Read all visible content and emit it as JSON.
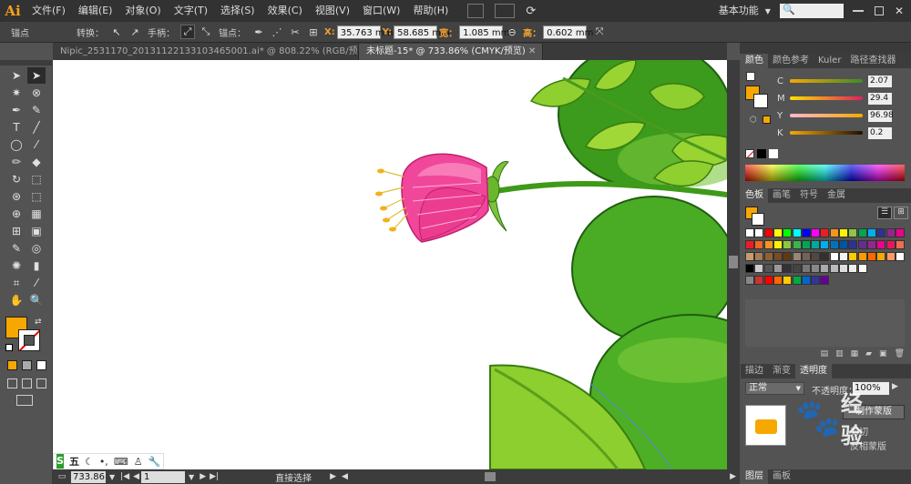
{
  "app": {
    "logo": "Ai",
    "menus": [
      "文件(F)",
      "编辑(E)",
      "对象(O)",
      "文字(T)",
      "选择(S)",
      "效果(C)",
      "视图(V)",
      "窗口(W)",
      "帮助(H)"
    ],
    "workspace": "基本功能",
    "search_placeholder": ""
  },
  "control_bar": {
    "tool_name": "锚点",
    "convert_label": "转换：",
    "handles_label": "手柄：",
    "anchors_label": "锚点：",
    "x_label": "X:",
    "x_value": "35.763 mm",
    "y_label": "Y:",
    "y_value": "58.685 mm",
    "w_label": "宽：",
    "w_value": "1.085 mm",
    "h_label": "高：",
    "h_value": "0.602 mm"
  },
  "tabs": [
    {
      "label": "Nipic_2531170_20131122133103465001.ai* @ 808.22% (RGB/预览)"
    },
    {
      "label": "未标题-15* @ 733.86% (CMYK/预览)"
    }
  ],
  "toolbox": {
    "icons": [
      "selection-tool-icon",
      "direct-selection-tool-icon",
      "magic-wand-tool-icon",
      "lasso-tool-icon",
      "pen-tool-icon",
      "curvature-tool-icon",
      "type-tool-icon",
      "line-tool-icon",
      "rectangle-tool-icon",
      "paintbrush-tool-icon",
      "pencil-tool-icon",
      "eraser-tool-icon",
      "rotate-tool-icon",
      "scale-tool-icon",
      "warp-tool-icon",
      "free-transform-tool-icon",
      "shape-builder-tool-icon",
      "perspective-tool-icon",
      "mesh-tool-icon",
      "gradient-tool-icon",
      "eyedropper-tool-icon",
      "blend-tool-icon",
      "symbol-sprayer-tool-icon",
      "column-graph-tool-icon",
      "artboard-tool-icon",
      "slice-tool-icon",
      "hand-tool-icon",
      "zoom-tool-icon"
    ]
  },
  "colors": {
    "fill": "#f7a800",
    "accent": "#f7a21b",
    "canvas": "#ffffff"
  },
  "color_panel": {
    "tabs": [
      "颜色",
      "颜色参考",
      "Kuler",
      "路径查找器"
    ],
    "c_label": "C",
    "c": "2.07",
    "m_label": "M",
    "m": "29.4",
    "y_label": "Y",
    "y": "96.98",
    "k_label": "K",
    "k": "0.2"
  },
  "swatches_panel": {
    "tabs": [
      "色板",
      "画笔",
      "符号",
      "金属"
    ]
  },
  "transparency_panel": {
    "tabs": [
      "描边",
      "渐变",
      "透明度"
    ],
    "mode": "正常",
    "opacity_label": "不透明度：",
    "opacity": "100%",
    "make_mask": "制作蒙版",
    "clip": "剪切",
    "invert": "反相蒙版"
  },
  "layers_panel": {
    "tabs": [
      "图层",
      "画板"
    ]
  },
  "status": {
    "zoom": "733.86",
    "page": "1",
    "tool": "直接选择"
  },
  "ime": {
    "label": "五"
  },
  "watermark": {
    "text": "经验"
  }
}
